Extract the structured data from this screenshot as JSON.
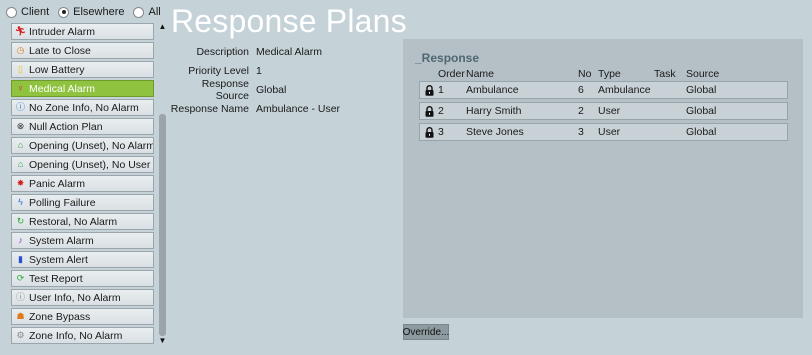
{
  "title": "Response Plans",
  "scope": {
    "options": [
      "Client",
      "Elsewhere",
      "All"
    ],
    "selected": "Elsewhere"
  },
  "plans": [
    {
      "label": "Intruder Alarm",
      "icon": "running-man-icon",
      "color": "#d62020"
    },
    {
      "label": "Late to Close",
      "icon": "clock-icon",
      "color": "#e07a20"
    },
    {
      "label": "Low Battery",
      "icon": "battery-icon",
      "color": "#e8c21a"
    },
    {
      "label": "Medical Alarm",
      "icon": "medical-person-icon",
      "color": "#d62020"
    },
    {
      "label": "No Zone Info, No Alarm",
      "icon": "info-icon",
      "color": "#2c6fd1"
    },
    {
      "label": "Null Action Plan",
      "icon": "null-circle-icon",
      "color": "#333333"
    },
    {
      "label": "Opening (Unset), No Alarm",
      "icon": "unlock-icon",
      "color": "#2faa3a"
    },
    {
      "label": "Opening (Unset), No User",
      "icon": "unlock-icon",
      "color": "#2faa3a"
    },
    {
      "label": "Panic Alarm",
      "icon": "panic-icon",
      "color": "#d62020"
    },
    {
      "label": "Polling Failure",
      "icon": "lightning-icon",
      "color": "#2c6fd1"
    },
    {
      "label": "Restoral, No Alarm",
      "icon": "restore-arrow-icon",
      "color": "#2faa3a"
    },
    {
      "label": "System Alarm",
      "icon": "system-alarm-icon",
      "color": "#9a2fd1"
    },
    {
      "label": "System Alert",
      "icon": "thermometer-icon",
      "color": "#2c4fd1"
    },
    {
      "label": "Test Report",
      "icon": "refresh-icon",
      "color": "#2faa3a"
    },
    {
      "label": "User Info, No Alarm",
      "icon": "user-info-icon",
      "color": "#888888"
    },
    {
      "label": "Zone Bypass",
      "icon": "bypass-icon",
      "color": "#e07a20"
    },
    {
      "label": "Zone Info, No Alarm",
      "icon": "gear-info-icon",
      "color": "#888888"
    }
  ],
  "selected_plan": "Medical Alarm",
  "details": [
    {
      "label": "Description",
      "value": "Medical Alarm"
    },
    {
      "label": "Priority Level",
      "value": "1"
    },
    {
      "label": "Response Source",
      "value": "Global"
    },
    {
      "label": "Response Name",
      "value": "Ambulance - User"
    }
  ],
  "response": {
    "title": "_Response",
    "columns": [
      "Order",
      "Name",
      "No",
      "Type",
      "Task",
      "Source"
    ],
    "rows": [
      {
        "order": "1",
        "name": "Ambulance",
        "no": "6",
        "type": "Ambulance",
        "task": "",
        "source": "Global"
      },
      {
        "order": "2",
        "name": "Harry Smith",
        "no": "2",
        "type": "User",
        "task": "",
        "source": "Global"
      },
      {
        "order": "3",
        "name": "Steve Jones",
        "no": "3",
        "type": "User",
        "task": "",
        "source": "Global"
      }
    ]
  },
  "override_label": "Override..."
}
